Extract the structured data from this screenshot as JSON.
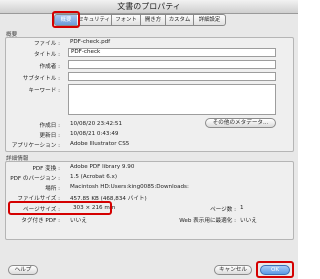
{
  "window": {
    "title": "文書のプロパティ"
  },
  "tabs": [
    {
      "label": "概要"
    },
    {
      "label": "セキュリティ"
    },
    {
      "label": "フォント"
    },
    {
      "label": "開き方"
    },
    {
      "label": "カスタム"
    },
    {
      "label": "詳細設定"
    }
  ],
  "overview": {
    "section_title": "概要",
    "file_label": "ファイル :",
    "file_value": "PDF-check.pdf",
    "title_label": "タイトル :",
    "title_value": "PDF-check",
    "author_label": "作成者 :",
    "author_value": "",
    "subtitle_label": "サブタイトル :",
    "subtitle_value": "",
    "keywords_label": "キーワード :",
    "keywords_value": "",
    "created_label": "作成日 :",
    "created_value": "10/08/20 23:42:51",
    "modified_label": "更新日 :",
    "modified_value": "10/08/21 0:43:49",
    "app_label": "アプリケーション :",
    "app_value": "Adobe Illustrator CS5",
    "metadata_button": "その他のメタデータ..."
  },
  "details": {
    "section_title": "詳細情報",
    "producer_label": "PDF 変換 :",
    "producer_value": "Adobe PDF library 9.90",
    "version_label": "PDF のバージョン :",
    "version_value": "1.5 (Acrobat 6.x)",
    "location_label": "場所 :",
    "location_value": "Macintosh HD:Users:king0085:Downloads:",
    "size_label": "ファイルサイズ :",
    "size_value": "457.85 KB (468,834 バイト)",
    "pagesize_label": "ページサイズ :",
    "pagesize_value": "303 × 216 mm",
    "tagged_label": "タグ付き PDF :",
    "tagged_value": "いいえ",
    "pages_label": "ページ数 :",
    "pages_value": "1",
    "fastweb_label": "Web 表示用に最適化 :",
    "fastweb_value": "いいえ"
  },
  "footer": {
    "help_label": "ヘルプ",
    "cancel_label": "キャンセル",
    "ok_label": "OK"
  },
  "colors": {
    "highlight": "#d40000",
    "accent": "#5a98e4"
  }
}
